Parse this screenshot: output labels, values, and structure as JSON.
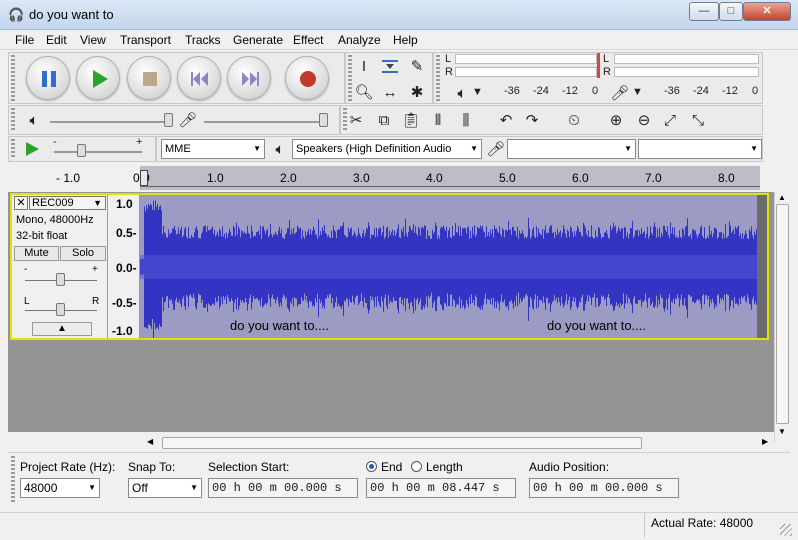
{
  "window": {
    "title": "do you want to",
    "minimize": "—",
    "maximize": "□",
    "close": "✕"
  },
  "menu": [
    "File",
    "Edit",
    "View",
    "Transport",
    "Tracks",
    "Generate",
    "Effect",
    "Analyze",
    "Help"
  ],
  "meter": {
    "L": "L",
    "R": "R",
    "play_ticks": [
      "-36",
      "-24",
      "-12",
      "0"
    ],
    "rec_ticks": [
      "-36",
      "-24",
      "-12",
      "0"
    ]
  },
  "device": {
    "host": "MME",
    "output": "Speakers (High Definition Audio",
    "input": "",
    "channels": ""
  },
  "ruler": [
    "- 1.0",
    "0.0",
    "1.0",
    "2.0",
    "3.0",
    "4.0",
    "5.0",
    "6.0",
    "7.0",
    "8.0"
  ],
  "track": {
    "name": "REC009",
    "info1": "Mono, 48000Hz",
    "info2": "32-bit float",
    "mute": "Mute",
    "solo": "Solo",
    "gain_minus": "-",
    "gain_plus": "+",
    "pan_l": "L",
    "pan_r": "R",
    "scale": [
      "1.0",
      "0.5-",
      "0.0-",
      "-0.5-",
      "-1.0"
    ],
    "label1": "do you want to....",
    "label2": "do you want to...."
  },
  "selection": {
    "rate_label": "Project Rate (Hz):",
    "rate": "48000",
    "snap_label": "Snap To:",
    "snap": "Off",
    "start_label": "Selection Start:",
    "start": "00 h 00 m 00.000 s",
    "end_label": "End",
    "length_label": "Length",
    "end": "00 h 00 m 08.447 s",
    "audio_pos_label": "Audio Position:",
    "audio_pos": "00 h 00 m 00.000 s"
  },
  "status": {
    "actual_rate": "Actual Rate: 48000"
  },
  "colors": {
    "wave": "#3434c4",
    "wave_bg": "#9b9bc4",
    "play": "#2aa52a",
    "record": "#c0392b",
    "pause": "#2f6fd0"
  }
}
